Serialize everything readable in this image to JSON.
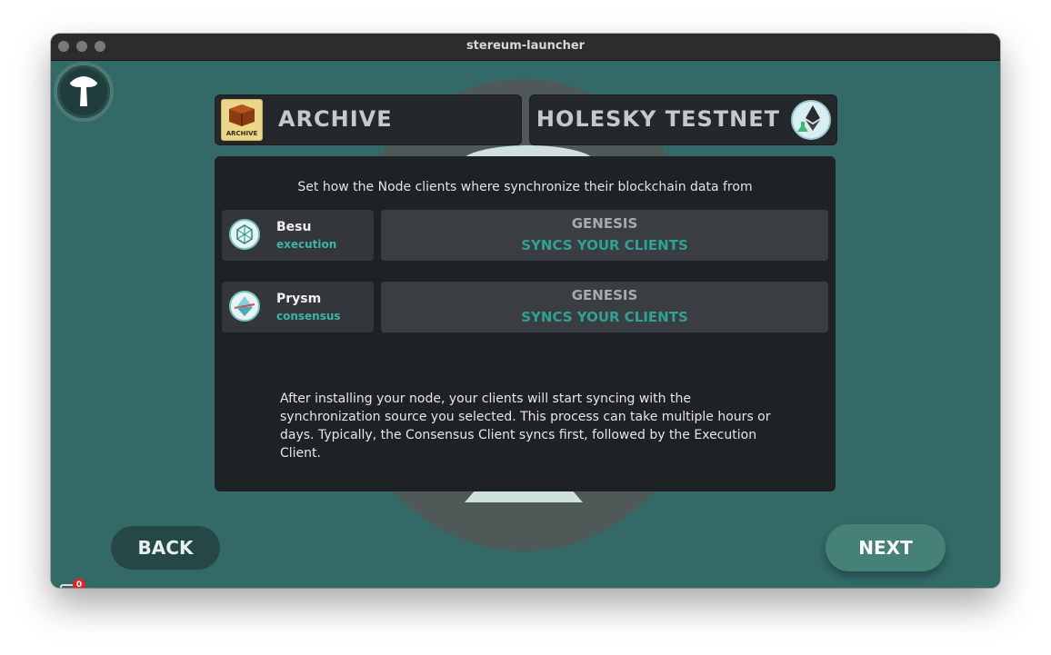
{
  "window": {
    "title": "stereum-launcher"
  },
  "header": {
    "setup_label": "ARCHIVE",
    "setup_icon_caption": "ARCHIVE",
    "network_label": "HOLESKY TESTNET"
  },
  "panel": {
    "intro": "Set how the Node clients where synchronize their blockchain data from",
    "clients": [
      {
        "name": "Besu",
        "type": "execution",
        "sync_source": "GENESIS",
        "sync_hint": "SYNCS YOUR CLIENTS"
      },
      {
        "name": "Prysm",
        "type": "consensus",
        "sync_source": "GENESIS",
        "sync_hint": "SYNCS YOUR CLIENTS"
      }
    ],
    "note": "After installing your node, your clients will start syncing with the synchronization source you selected. This process can take multiple hours or days. Typically, the Consensus Client syncs first, followed by the Execution Client."
  },
  "nav": {
    "back_label": "BACK",
    "next_label": "NEXT"
  },
  "notifications": {
    "count": "0"
  },
  "colors": {
    "accent": "#2fa393",
    "background": "#336a68",
    "panel": "#1f2225"
  }
}
